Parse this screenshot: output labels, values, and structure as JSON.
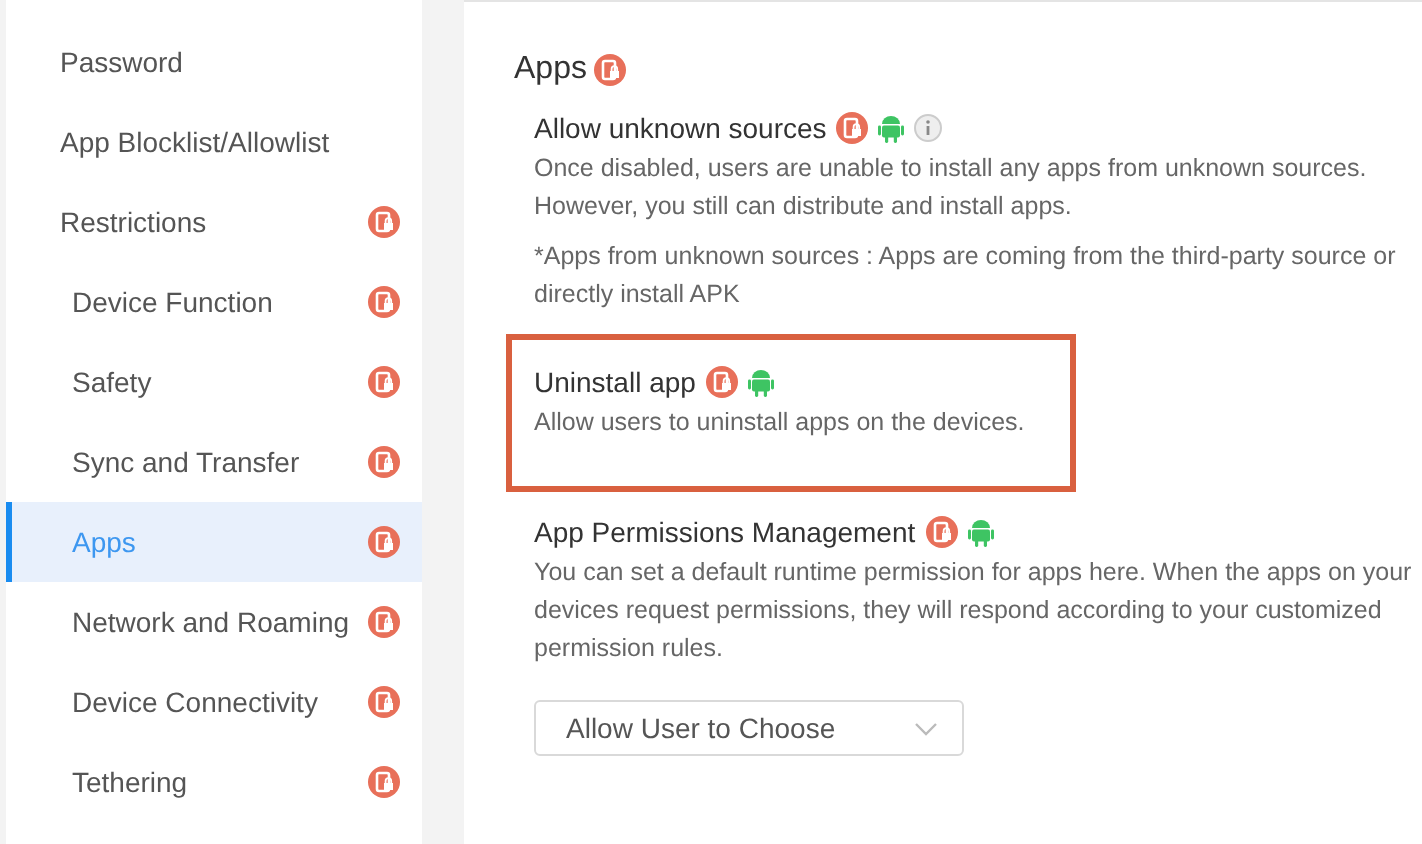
{
  "sidebar": {
    "items": [
      {
        "label": "Password",
        "badge": false,
        "selected": false
      },
      {
        "label": "App Blocklist/Allowlist",
        "badge": false,
        "selected": false
      },
      {
        "label": "Restrictions",
        "badge": true,
        "selected": false,
        "children": [
          {
            "label": "Device Function",
            "badge": true,
            "selected": false
          },
          {
            "label": "Safety",
            "badge": true,
            "selected": false
          },
          {
            "label": "Sync and Transfer",
            "badge": true,
            "selected": false
          },
          {
            "label": "Apps",
            "badge": true,
            "selected": true
          },
          {
            "label": "Network and Roaming",
            "badge": true,
            "selected": false
          },
          {
            "label": "Device Connectivity",
            "badge": true,
            "selected": false
          },
          {
            "label": "Tethering",
            "badge": true,
            "selected": false
          }
        ]
      }
    ]
  },
  "section": {
    "title": "Apps",
    "badge": true,
    "settings": [
      {
        "title": "Allow unknown sources",
        "device_lock": true,
        "android": true,
        "info": true,
        "highlighted": false,
        "paragraphs": [
          "Once disabled, users are unable to install any apps from unknown sources. However, you still can distribute and install apps.",
          "*Apps from unknown sources : Apps are coming from the third-party source or directly install APK"
        ]
      },
      {
        "title": "Uninstall app",
        "device_lock": true,
        "android": true,
        "highlighted": true,
        "paragraphs": [
          "Allow users to uninstall apps on the devices."
        ]
      },
      {
        "title": "App Permissions Management",
        "device_lock": true,
        "android": true,
        "highlighted": false,
        "paragraphs": [
          "You can set a default runtime permission for apps here. When the apps on your devices request permissions, they will respond according to your customized permission rules."
        ],
        "select": {
          "value": "Allow User to Choose"
        }
      }
    ]
  }
}
